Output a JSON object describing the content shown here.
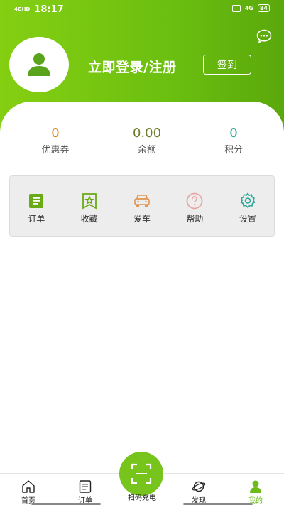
{
  "status_bar": {
    "network_label": "4GHD",
    "time": "18:17",
    "signal_label": "4G",
    "battery": "84"
  },
  "profile": {
    "login_text": "立即登录/注册",
    "signin_label": "签到"
  },
  "stats": [
    {
      "value": "0",
      "label": "优惠券",
      "color": "#d4861f"
    },
    {
      "value": "0.00",
      "label": "余额",
      "color": "#6f7d2a"
    },
    {
      "value": "0",
      "label": "积分",
      "color": "#2aa89a"
    }
  ],
  "menu": [
    {
      "label": "订单",
      "icon": "order-icon",
      "color": "#6aaa16"
    },
    {
      "label": "收藏",
      "icon": "favorite-icon",
      "color": "#6aaa16"
    },
    {
      "label": "爱车",
      "icon": "car-icon",
      "color": "#e09552"
    },
    {
      "label": "帮助",
      "icon": "help-icon",
      "color": "#e8a4a4"
    },
    {
      "label": "设置",
      "icon": "settings-icon",
      "color": "#2aa89a"
    }
  ],
  "tabbar": {
    "home": "首页",
    "orders": "订单",
    "scan": "扫码充电",
    "discover": "发现",
    "mine": "我的",
    "active_color": "#6cbb1a"
  }
}
